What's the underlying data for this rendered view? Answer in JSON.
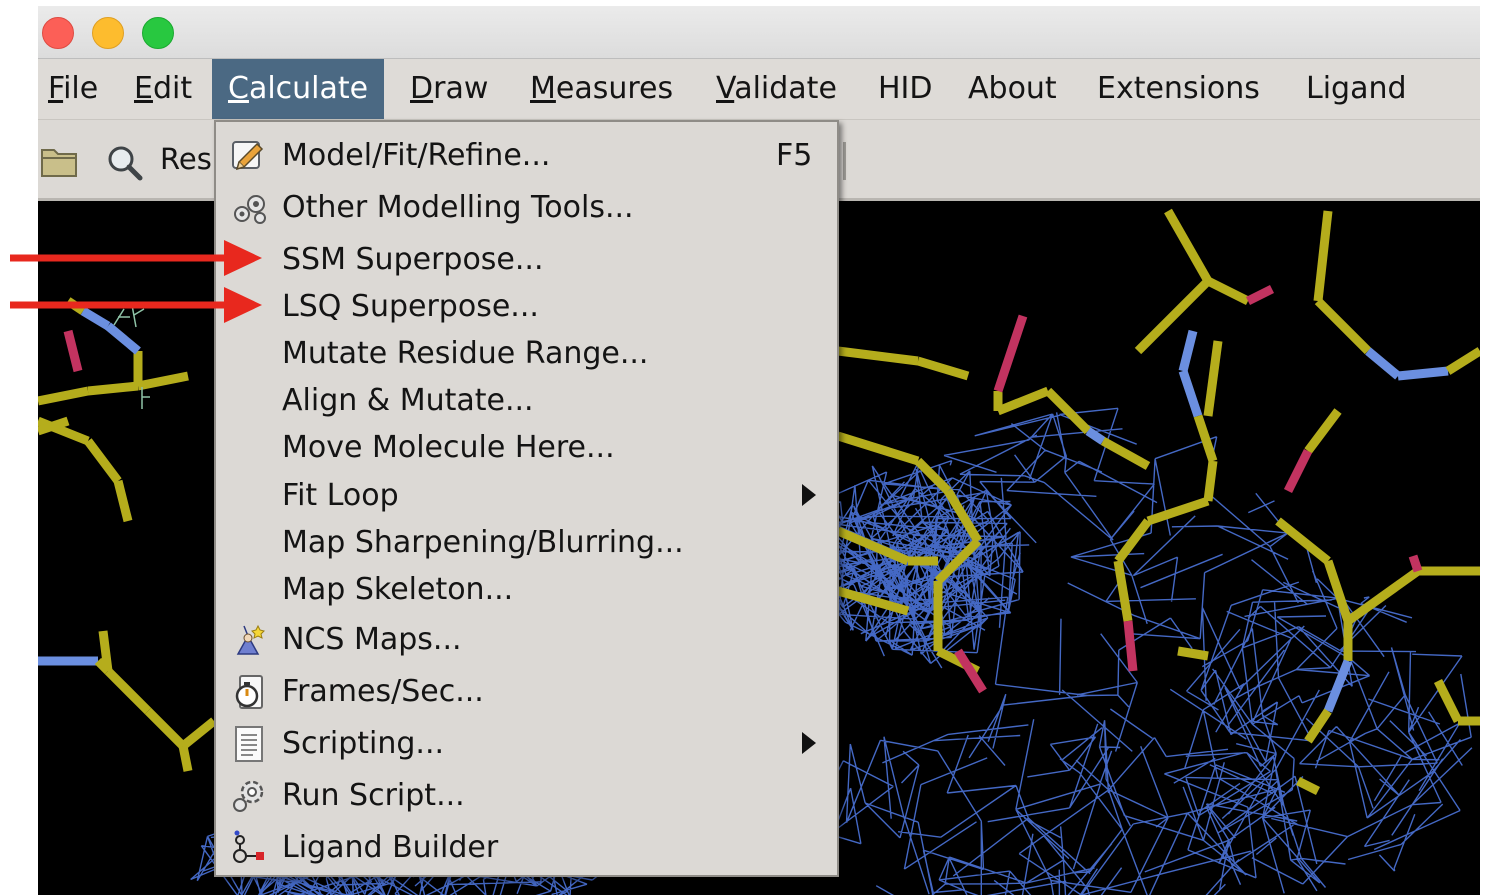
{
  "menubar": {
    "items": [
      {
        "mnemonic": "F",
        "rest": "ile"
      },
      {
        "mnemonic": "E",
        "rest": "dit"
      },
      {
        "mnemonic": "C",
        "rest": "alculate"
      },
      {
        "mnemonic": "D",
        "rest": "raw"
      },
      {
        "mnemonic": "M",
        "rest": "easures"
      },
      {
        "mnemonic": "V",
        "rest": "alidate"
      },
      {
        "mnemonic": "",
        "rest": "HID"
      },
      {
        "mnemonic": "",
        "rest": "About"
      },
      {
        "mnemonic": "",
        "rest": "Extensions"
      },
      {
        "mnemonic": "",
        "rest": "Ligand"
      }
    ]
  },
  "toolbar": {
    "res_label": "Res"
  },
  "calculate_menu": {
    "items": [
      {
        "label": "Model/Fit/Refine...",
        "icon": "model-fit-refine-icon",
        "accel": "F5"
      },
      {
        "label": "Other Modelling Tools...",
        "icon": "gears-icon"
      },
      {
        "label": "SSM Superpose..."
      },
      {
        "label": "LSQ Superpose..."
      },
      {
        "label": "Mutate Residue Range..."
      },
      {
        "label": "Align & Mutate..."
      },
      {
        "label": "Move Molecule Here..."
      },
      {
        "label": "Fit Loop",
        "submenu": true
      },
      {
        "label": "Map Sharpening/Blurring..."
      },
      {
        "label": "Map Skeleton..."
      },
      {
        "label": "NCS Maps...",
        "icon": "wizard-icon"
      },
      {
        "label": "Frames/Sec...",
        "icon": "stopwatch-icon"
      },
      {
        "label": "Scripting...",
        "icon": "document-icon",
        "submenu": true
      },
      {
        "label": "Run Script...",
        "icon": "gear-icon"
      },
      {
        "label": "Ligand Builder",
        "icon": "molecule-icon"
      }
    ]
  },
  "colors": {
    "menu_highlight": "#4b6983",
    "annotation_arrow": "#e8281e",
    "viewport_background": "#000000",
    "map_mesh": "#4468c4",
    "carbon_bond": "#b5ad1c",
    "nitrogen_bond": "#6b8fe0",
    "oxygen_bond": "#c23360"
  }
}
